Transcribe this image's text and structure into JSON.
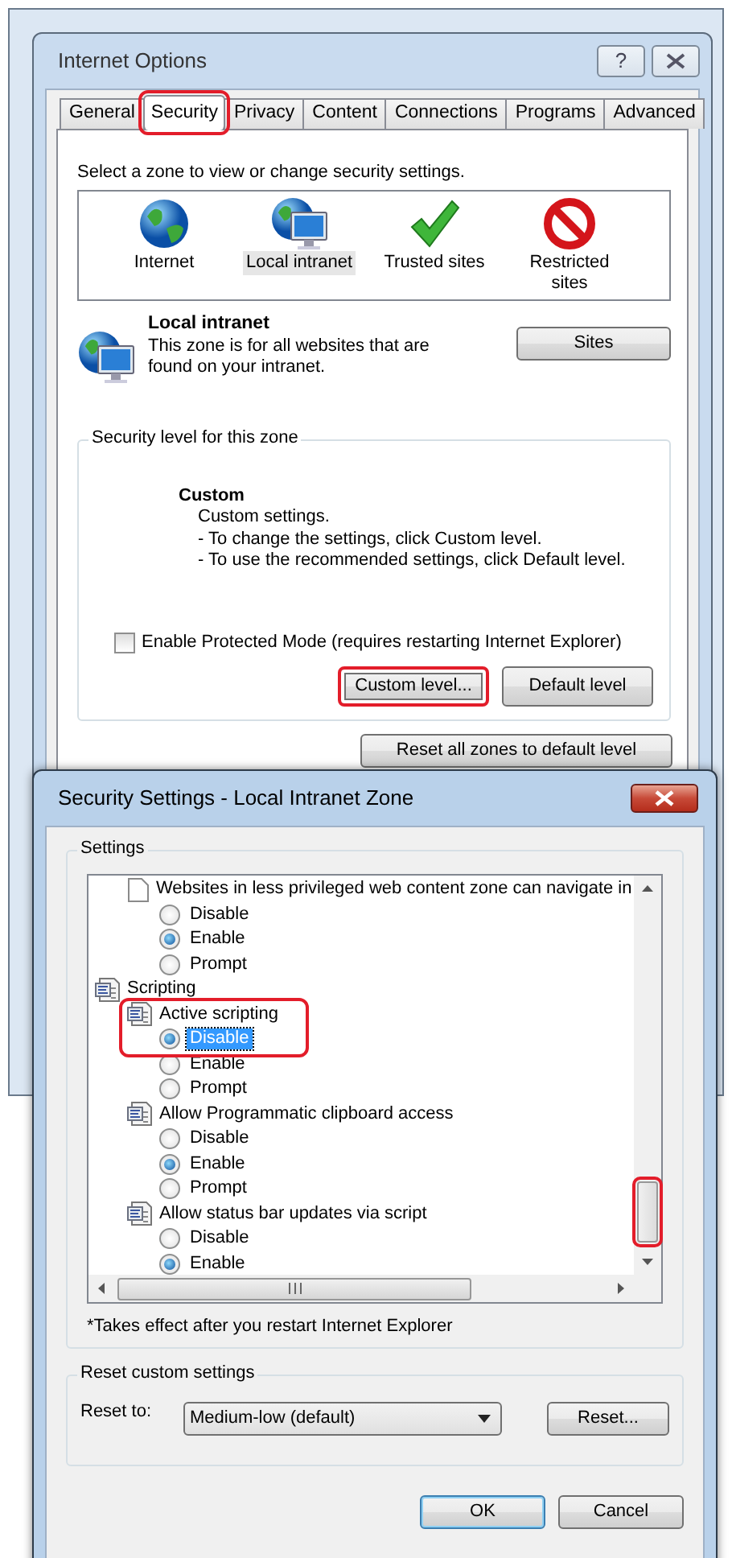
{
  "internet_options": {
    "title": "Internet Options",
    "help_button": "?",
    "tabs": [
      {
        "label": "General",
        "selected": false,
        "highlighted": false
      },
      {
        "label": "Security",
        "selected": true,
        "highlighted": true
      },
      {
        "label": "Privacy",
        "selected": false,
        "highlighted": false
      },
      {
        "label": "Content",
        "selected": false,
        "highlighted": false
      },
      {
        "label": "Connections",
        "selected": false,
        "highlighted": false
      },
      {
        "label": "Programs",
        "selected": false,
        "highlighted": false
      },
      {
        "label": "Advanced",
        "selected": false,
        "highlighted": false
      }
    ],
    "zone_prompt": "Select a zone to view or change security settings.",
    "zones": [
      {
        "label": "Internet",
        "kind": "internet",
        "selected": false
      },
      {
        "label": "Local intranet",
        "kind": "intranet",
        "selected": true
      },
      {
        "label": "Trusted sites",
        "kind": "trusted",
        "selected": false
      },
      {
        "label": "Restricted sites",
        "kind": "restricted",
        "selected": false
      }
    ],
    "zone_info": {
      "kind": "intranet",
      "name": "Local intranet",
      "description": "This zone is for all websites that are found on your intranet."
    },
    "sites_button": "Sites",
    "security_level": {
      "legend": "Security level for this zone",
      "level_name": "Custom",
      "lines": [
        "Custom settings.",
        "- To change the settings, click Custom level.",
        "- To use the recommended settings, click Default level."
      ],
      "protected_mode": {
        "label": "Enable Protected Mode (requires restarting Internet Explorer)",
        "checked": false
      },
      "buttons": [
        {
          "label": "Custom level...",
          "highlighted": true
        },
        {
          "label": "Default level",
          "highlighted": false
        }
      ]
    },
    "reset_all_button": "Reset all zones to default level"
  },
  "security_settings": {
    "title": "Security Settings - Local Intranet Zone",
    "settings_legend": "Settings",
    "tree": [
      {
        "kind": "setting",
        "label": "Websites in less privileged web content zone can navigate in",
        "highlighted": false,
        "options": [
          {
            "label": "Disable",
            "selected": false,
            "focused": false
          },
          {
            "label": "Enable",
            "selected": true,
            "focused": false
          },
          {
            "label": "Prompt",
            "selected": false,
            "focused": false
          }
        ]
      },
      {
        "kind": "category",
        "label": "Scripting",
        "children": [
          {
            "kind": "setting",
            "label": "Active scripting",
            "highlighted": true,
            "options": [
              {
                "label": "Disable",
                "selected": true,
                "focused": true
              },
              {
                "label": "Enable",
                "selected": false,
                "focused": false
              },
              {
                "label": "Prompt",
                "selected": false,
                "focused": false
              }
            ]
          },
          {
            "kind": "setting",
            "label": "Allow Programmatic clipboard access",
            "highlighted": false,
            "options": [
              {
                "label": "Disable",
                "selected": false,
                "focused": false
              },
              {
                "label": "Enable",
                "selected": true,
                "focused": false
              },
              {
                "label": "Prompt",
                "selected": false,
                "focused": false
              }
            ]
          },
          {
            "kind": "setting",
            "label": "Allow status bar updates via script",
            "highlighted": false,
            "options": [
              {
                "label": "Disable",
                "selected": false,
                "focused": false
              },
              {
                "label": "Enable",
                "selected": true,
                "focused": false
              }
            ]
          }
        ]
      }
    ],
    "scrollbar_highlighted": true,
    "footnote": "*Takes effect after you restart Internet Explorer",
    "reset_legend": "Reset custom settings",
    "reset_label": "Reset to:",
    "reset_value": "Medium-low (default)",
    "reset_button": "Reset...",
    "ok_button": "OK",
    "cancel_button": "Cancel"
  }
}
